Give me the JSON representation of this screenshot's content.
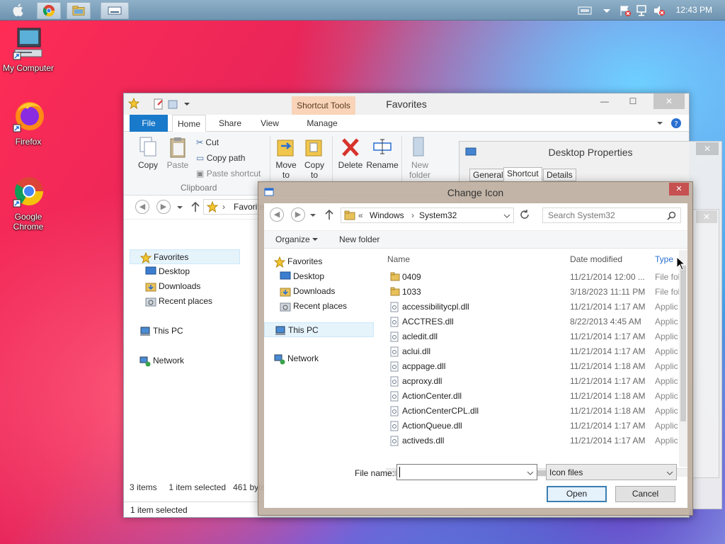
{
  "topbar": {
    "clock": "12:43 PM"
  },
  "desktop": {
    "icons": [
      {
        "label": "My Computer"
      },
      {
        "label": "Firefox"
      },
      {
        "label": "Google Chrome"
      }
    ]
  },
  "explorer": {
    "title": "Favorites",
    "context_tab": "Shortcut Tools",
    "tabs": [
      "File",
      "Home",
      "Share",
      "View",
      "Manage"
    ],
    "ribbon": {
      "copy": "Copy",
      "paste": "Paste",
      "cut": "Cut",
      "copy_path": "Copy path",
      "paste_shortcut": "Paste shortcut",
      "clipboard_group": "Clipboard",
      "move_to": "Move to",
      "copy_to": "Copy to",
      "delete": "Delete",
      "rename": "Rename",
      "new_folder": "New folder"
    },
    "address": "Favorites",
    "nav": [
      "Favorites",
      "Desktop",
      "Downloads",
      "Recent places",
      "This PC",
      "Network"
    ],
    "status_items": "3 items",
    "status_selected": "1 item selected",
    "status_size": "461 bytes",
    "status_bar": "1 item selected"
  },
  "properties": {
    "title": "Desktop Properties",
    "tabs": [
      "General",
      "Shortcut",
      "Details"
    ]
  },
  "dialog": {
    "title": "Change Icon",
    "breadcrumb_prefix": "«",
    "breadcrumb": [
      "Windows",
      "System32"
    ],
    "search_placeholder": "Search System32",
    "organize": "Organize",
    "new_folder": "New folder",
    "nav": [
      "Favorites",
      "Desktop",
      "Downloads",
      "Recent places",
      "This PC",
      "Network"
    ],
    "columns": {
      "name": "Name",
      "date": "Date modified",
      "type": "Type"
    },
    "rows": [
      {
        "name": "0409",
        "date": "11/21/2014 12:00 ...",
        "type": "File fol"
      },
      {
        "name": "1033",
        "date": "3/18/2023 11:11 PM",
        "type": "File fol"
      },
      {
        "name": "accessibilitycpl.dll",
        "date": "11/21/2014 1:17 AM",
        "type": "Applic"
      },
      {
        "name": "ACCTRES.dll",
        "date": "8/22/2013 4:45 AM",
        "type": "Applic"
      },
      {
        "name": "acledit.dll",
        "date": "11/21/2014 1:17 AM",
        "type": "Applic"
      },
      {
        "name": "aclui.dll",
        "date": "11/21/2014 1:17 AM",
        "type": "Applic"
      },
      {
        "name": "acppage.dll",
        "date": "11/21/2014 1:18 AM",
        "type": "Applic"
      },
      {
        "name": "acproxy.dll",
        "date": "11/21/2014 1:17 AM",
        "type": "Applic"
      },
      {
        "name": "ActionCenter.dll",
        "date": "11/21/2014 1:18 AM",
        "type": "Applic"
      },
      {
        "name": "ActionCenterCPL.dll",
        "date": "11/21/2014 1:18 AM",
        "type": "Applic"
      },
      {
        "name": "ActionQueue.dll",
        "date": "11/21/2014 1:17 AM",
        "type": "Applic"
      },
      {
        "name": "activeds.dll",
        "date": "11/21/2014 1:17 AM",
        "type": "Applic"
      }
    ],
    "file_name_label": "File name:",
    "file_name_value": "",
    "file_type": "Icon files",
    "open": "Open",
    "cancel": "Cancel"
  },
  "colors": {
    "ribbon_file": "#1979ca",
    "shortcut_tools": "#f9d4b8",
    "close_red": "#c75050",
    "dialog_frame": "#beafa0"
  }
}
